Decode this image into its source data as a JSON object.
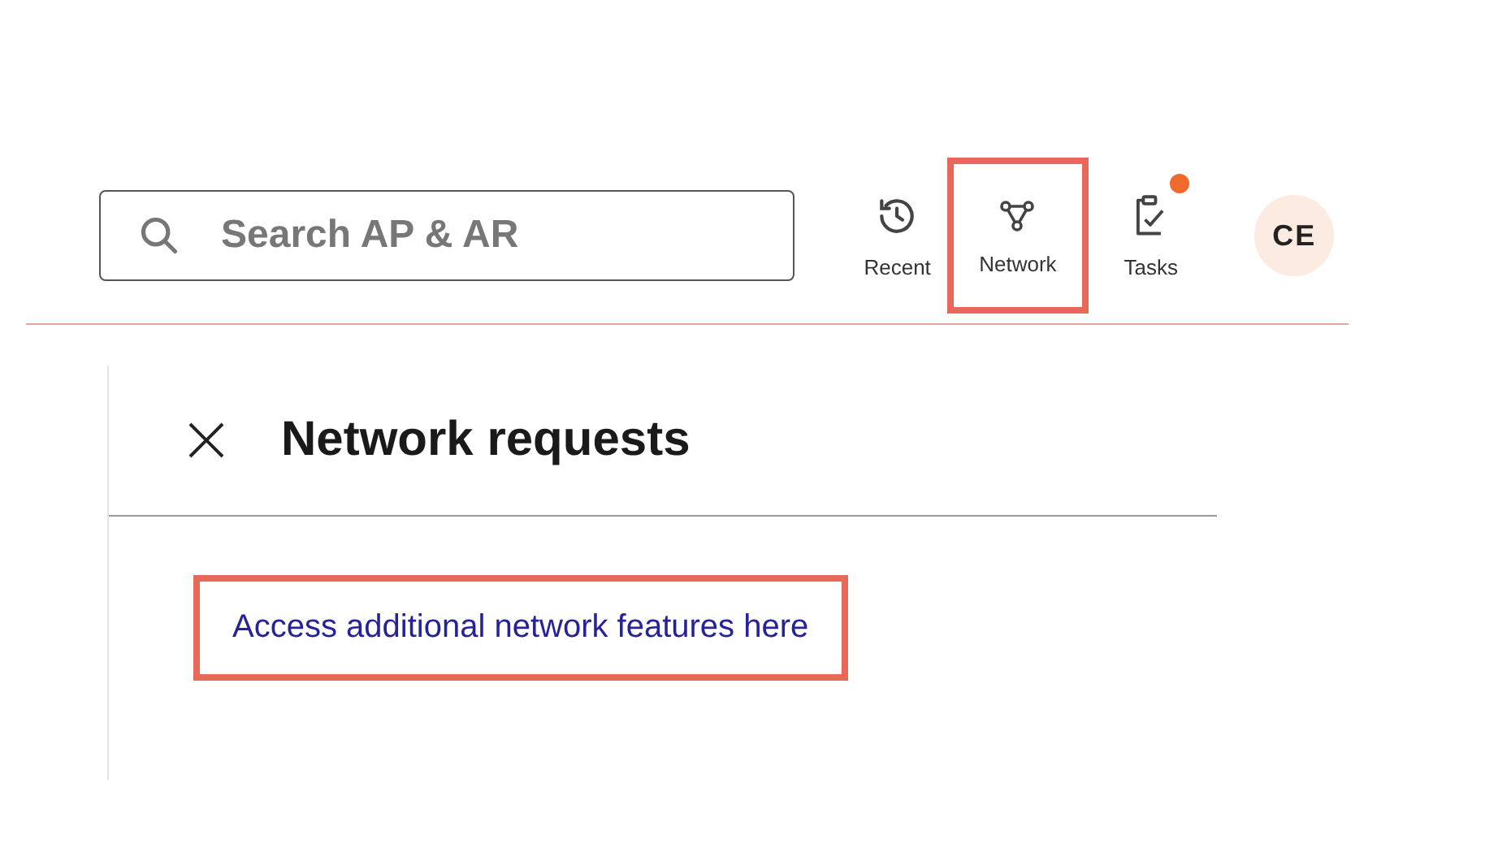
{
  "header": {
    "search": {
      "placeholder": "Search AP & AR"
    },
    "nav_items": [
      {
        "kind": "recent",
        "label": "Recent",
        "highlighted": false,
        "badge": false
      },
      {
        "kind": "network",
        "label": "Network",
        "highlighted": true,
        "badge": false
      },
      {
        "kind": "tasks",
        "label": "Tasks",
        "highlighted": false,
        "badge": true
      }
    ],
    "avatar": {
      "initials": "CE"
    }
  },
  "panel": {
    "title": "Network requests",
    "link": {
      "label": "Access additional network features here",
      "highlighted": true
    }
  }
}
